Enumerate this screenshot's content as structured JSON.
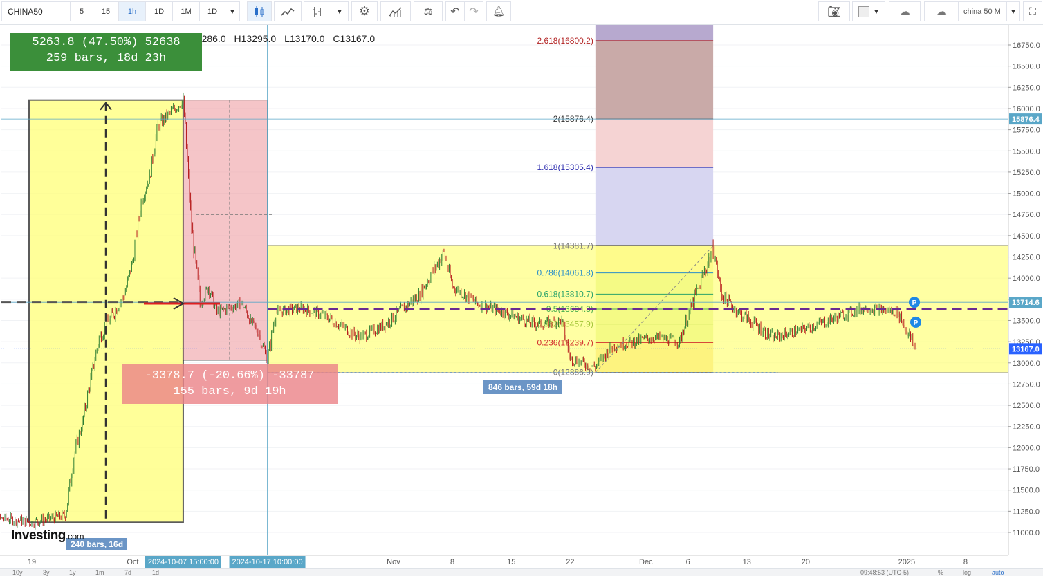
{
  "toolbar": {
    "symbol": "CHINA50",
    "intervals": [
      "5",
      "15",
      "1h",
      "1D",
      "1M",
      "1D"
    ],
    "active_interval": "1h",
    "search_text": "china 50 M"
  },
  "ohlc": {
    "open": "13286.0",
    "high": "H13295.0",
    "low": "L13170.0",
    "close": "C13167.0"
  },
  "measure_boxes": {
    "up": {
      "line1": "5263.8 (47.50%) 52638",
      "line2": "259 bars, 18d 23h"
    },
    "down": {
      "line1": "-3378.7 (-20.66%) -33787",
      "line2": "155 bars, 9d 19h"
    },
    "range_label": "846 bars, 59d 18h",
    "small_range_label": "240 bars, 16d"
  },
  "fib_levels": [
    {
      "label": "2.618(16800.2)",
      "value": 16800.2,
      "color": "#b22222"
    },
    {
      "label": "2(15876.4)",
      "value": 15876.4,
      "color": "#333333"
    },
    {
      "label": "1.618(15305.4)",
      "value": 15305.4,
      "color": "#3030b0"
    },
    {
      "label": "1(14381.7)",
      "value": 14381.7,
      "color": "#777777"
    },
    {
      "label": "0.786(14061.8)",
      "value": 14061.8,
      "color": "#2a8fc9"
    },
    {
      "label": "0.618(13810.7)",
      "value": 13810.7,
      "color": "#2aa36a"
    },
    {
      "label": "0.5(13634.3)",
      "value": 13634.3,
      "color": "#4caf50"
    },
    {
      "label": "0.382(13457.9)",
      "value": 13457.9,
      "color": "#a4c639"
    },
    {
      "label": "0.236(13239.7)",
      "value": 13239.7,
      "color": "#d32f2f"
    },
    {
      "label": "0(12886.9)",
      "value": 12886.9,
      "color": "#777777"
    }
  ],
  "price_tags": [
    {
      "label": "15876.4",
      "value": 15876.4,
      "color": "#5aa7c8"
    },
    {
      "label": "13714.6",
      "value": 13714.6,
      "color": "#5aa7c8"
    },
    {
      "label": "13167.0",
      "value": 13167.0,
      "color": "#2962ff"
    }
  ],
  "x_axis": {
    "tick_labels": [
      "19",
      "Oct",
      "Nov",
      "8",
      "15",
      "22",
      "Dec",
      "6",
      "13",
      "20",
      "2025",
      "8"
    ],
    "highlight_labels": [
      "2024-10-07 15:00:00",
      "2024-10-17 10:00:00"
    ]
  },
  "bottom_bar": {
    "ranges": [
      "10y",
      "3y",
      "1y",
      "1m",
      "7d",
      "1d"
    ],
    "time": "09:48:53 (UTC-5)",
    "options": [
      "%",
      "log",
      "auto"
    ]
  },
  "logo": {
    "brand": "Investing",
    "suffix": ".com"
  },
  "chart_data": {
    "type": "candlestick",
    "title": "",
    "ylim": [
      10800,
      17050
    ],
    "y_ticks": [
      11000,
      11250,
      11500,
      11750,
      12000,
      12250,
      12500,
      12750,
      13000,
      13250,
      13500,
      13750,
      14000,
      14250,
      14500,
      14750,
      15000,
      15250,
      15500,
      15750,
      16000,
      16250,
      16500,
      16750
    ],
    "y_tick_labels": [
      "11000.0",
      "11250.0",
      "11500.0",
      "11750.0",
      "12000.0",
      "12250.0",
      "12500.0",
      "12750.0",
      "13000.0",
      "13250.0",
      "13500.0",
      "13750.0",
      "14000.0",
      "14250.0",
      "14500.0",
      "14750.0",
      "15000.0",
      "15250.0",
      "15500.0",
      "15750.0",
      "16000.0",
      "16250.0",
      "16500.0",
      "16750.0"
    ],
    "price_path": [
      [
        "2024-09-13",
        11180
      ],
      [
        "2024-09-17",
        11150
      ],
      [
        "2024-09-19",
        11120
      ],
      [
        "2024-09-23",
        11200
      ],
      [
        "2024-09-24",
        11900
      ],
      [
        "2024-09-25",
        12300
      ],
      [
        "2024-09-26",
        12800
      ],
      [
        "2024-09-27",
        13300
      ],
      [
        "2024-09-30",
        13800
      ],
      [
        "2024-10-01",
        14200
      ],
      [
        "2024-10-02",
        14900
      ],
      [
        "2024-10-03",
        15200
      ],
      [
        "2024-10-04",
        15800
      ],
      [
        "2024-10-07",
        16100
      ],
      [
        "2024-10-08",
        14600
      ],
      [
        "2024-10-09",
        13700
      ],
      [
        "2024-10-10",
        13900
      ],
      [
        "2024-10-11",
        13600
      ],
      [
        "2024-10-14",
        13700
      ],
      [
        "2024-10-15",
        13500
      ],
      [
        "2024-10-16",
        13350
      ],
      [
        "2024-10-17",
        13030
      ],
      [
        "2024-10-18",
        13600
      ],
      [
        "2024-10-21",
        13650
      ],
      [
        "2024-10-24",
        13550
      ],
      [
        "2024-10-28",
        13300
      ],
      [
        "2024-10-31",
        13450
      ],
      [
        "2024-11-04",
        13800
      ],
      [
        "2024-11-07",
        14300
      ],
      [
        "2024-11-08",
        13900
      ],
      [
        "2024-11-11",
        13700
      ],
      [
        "2024-11-14",
        13600
      ],
      [
        "2024-11-18",
        13450
      ],
      [
        "2024-11-21",
        13500
      ],
      [
        "2024-11-22",
        13050
      ],
      [
        "2024-11-25",
        12950
      ],
      [
        "2024-11-27",
        13200
      ],
      [
        "2024-12-02",
        13300
      ],
      [
        "2024-12-05",
        13250
      ],
      [
        "2024-12-06",
        13550
      ],
      [
        "2024-12-09",
        14350
      ],
      [
        "2024-12-10",
        13800
      ],
      [
        "2024-12-12",
        13600
      ],
      [
        "2024-12-16",
        13300
      ],
      [
        "2024-12-20",
        13400
      ],
      [
        "2024-12-24",
        13550
      ],
      [
        "2024-12-27",
        13650
      ],
      [
        "2024-12-31",
        13600
      ],
      [
        "2025-01-02",
        13167
      ]
    ],
    "horizontal_lines": [
      15876.4,
      13714.6,
      13167.0,
      13634.3
    ],
    "x_range": [
      "2024-09-12",
      "2025-01-15"
    ]
  }
}
